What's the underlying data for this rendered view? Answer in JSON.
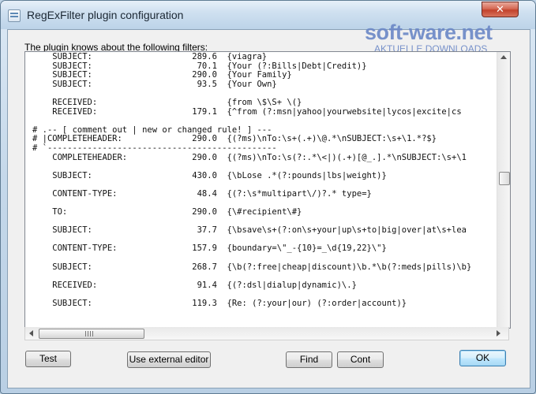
{
  "window": {
    "title": "RegExFilter plugin configuration",
    "close_glyph": "✕"
  },
  "watermark": {
    "brand": "soft-ware.net",
    "tagline": "AKTUELLE DOWNLOADS"
  },
  "content": {
    "label": "The plugin knows about the following filters:",
    "lines": [
      "    SUBJECT:                    289.6  {viagra}",
      "    SUBJECT:                     70.1  {Your (?:Bills|Debt|Credit)}",
      "    SUBJECT:                    290.0  {Your Family}",
      "    SUBJECT:                     93.5  {Your Own}",
      "",
      "    RECEIVED:                          {from \\$\\S+ \\(}",
      "    RECEIVED:                   179.1  {^from (?:msn|yahoo|yourwebsite|lycos|excite|cs",
      "",
      "# .-- [ comment out | new or changed rule! ] ---",
      "# |COMPLETEHEADER:              290.0  {(?ms)\\nTo:\\s+(.+)\\@.*\\nSUBJECT:\\s+\\1.*?$}",
      "# `----------------------------------------------",
      "    COMPLETEHEADER:             290.0  {(?ms)\\nTo:\\s(?:.*\\<|)(.+)[@_.].*\\nSUBJECT:\\s+\\1",
      "",
      "    SUBJECT:                    430.0  {\\bLose .*(?:pounds|lbs|weight)}",
      "",
      "    CONTENT-TYPE:                48.4  {(?:\\s*multipart\\/)?.* type=}",
      "",
      "    TO:                         290.0  {\\#recipient\\#}",
      "",
      "    SUBJECT:                     37.7  {\\bsave\\s+(?:on\\s+your|up\\s+to|big|over|at\\s+lea",
      "",
      "    CONTENT-TYPE:               157.9  {boundary=\\\"_-{10}=_\\d{19,22}\\\"}",
      "",
      "    SUBJECT:                    268.7  {\\b(?:free|cheap|discount)\\b.*\\b(?:meds|pills)\\b}",
      "",
      "    RECEIVED:                    91.4  {(?:dsl|dialup|dynamic)\\.}",
      "",
      "    SUBJECT:                    119.3  {Re: (?:your|our) (?:order|account)}",
      ""
    ]
  },
  "buttons": {
    "test": "Test",
    "external_editor": "Use external editor",
    "find": "Find",
    "cont": "Cont",
    "ok": "OK"
  },
  "scrollbar": {
    "grip_glyph": "III"
  }
}
